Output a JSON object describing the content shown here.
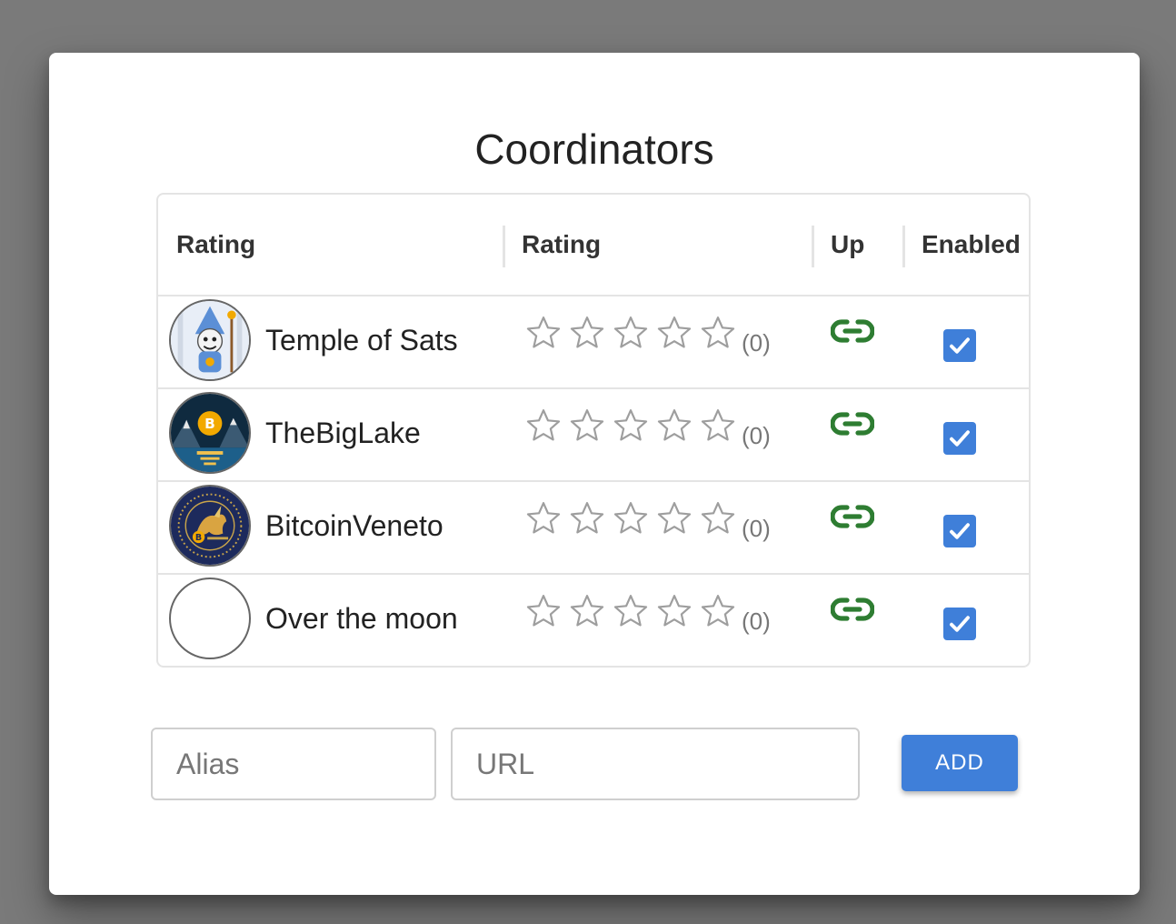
{
  "dialog": {
    "title": "Coordinators"
  },
  "table": {
    "headers": {
      "col1": "Rating",
      "col2": "Rating",
      "col3": "Up",
      "col4": "Enabled"
    },
    "rows": [
      {
        "name": "Temple of Sats",
        "avatar": "wizard-avatar-icon",
        "rating": 0,
        "rating_count": "(0)",
        "up_icon": "link-icon",
        "enabled": true
      },
      {
        "name": "TheBigLake",
        "avatar": "lake-avatar-icon",
        "rating": 0,
        "rating_count": "(0)",
        "up_icon": "link-icon",
        "enabled": true
      },
      {
        "name": "BitcoinVeneto",
        "avatar": "lion-avatar-icon",
        "rating": 0,
        "rating_count": "(0)",
        "up_icon": "link-icon",
        "enabled": true
      },
      {
        "name": "Over the moon",
        "avatar": "empty-avatar",
        "rating": 0,
        "rating_count": "(0)",
        "up_icon": "link-icon",
        "enabled": true
      }
    ]
  },
  "form": {
    "alias_placeholder": "Alias",
    "alias_value": "",
    "url_placeholder": "URL",
    "url_value": "",
    "add_label": "ADD"
  },
  "colors": {
    "accent": "#3f7fd9",
    "link_green": "#2e7d32",
    "star_outline": "#9e9e9e"
  }
}
